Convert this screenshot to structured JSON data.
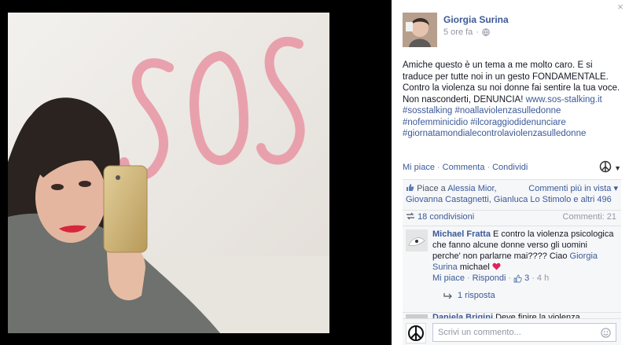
{
  "window": {
    "close_glyph": "×"
  },
  "photo": {
    "wall_text": "SOS",
    "alt": "Selfie in front of a wall with SOS written in lipstick"
  },
  "post": {
    "author": "Giorgia Surina",
    "time": "5 ore fa",
    "privacy_icon": "globe-icon",
    "text_lines": [
      "Amiche questo è un tema a me molto caro. E si",
      "traduce per tutte noi in un gesto FONDAMENTALE.",
      "Contro la violenza su noi donne fai sentire la tua voce.",
      "Non nasconderti, DENUNCIA! "
    ],
    "url": "www.sos-stalking.it",
    "hashtags": [
      "#sosstalking #noallaviolenzasulledonne",
      "#nofemminicidio #ilcoraggiodidenunciare",
      "#giornatamondialecontrolaviolenzasulledonne"
    ],
    "actions": {
      "like": "Mi piace",
      "comment": "Commenta",
      "share": "Condividi",
      "dot": "·"
    }
  },
  "ufi": {
    "likes_prefix": "Piace a ",
    "likes_first": "Alessia Mior",
    "likes_sep": ",",
    "likes_more_label": "Commenti più in vista",
    "likes_second_line": "Giovanna Castagnetti, Gianluca Lo Stimolo e altri 496",
    "shares": "18 condivisioni",
    "comments_count": "Commenti: 21"
  },
  "comment": {
    "author": "Michael Fratta",
    "text_before": " E contro la violenza psicologica che fanno alcune donne verso gli uomini perche' non parlarne mai???? Ciao ",
    "mention": "Giorgia Surina",
    "text_after": " michael ",
    "like": "Mi piace",
    "reply": "Rispondi",
    "likes_count": "3",
    "time": "4 h",
    "replies": "1 risposta"
  },
  "next_comment": {
    "author": "Daniela Brigini",
    "text": " Deve finire la violenza"
  },
  "composer": {
    "placeholder": "Scrivi un commento..."
  }
}
